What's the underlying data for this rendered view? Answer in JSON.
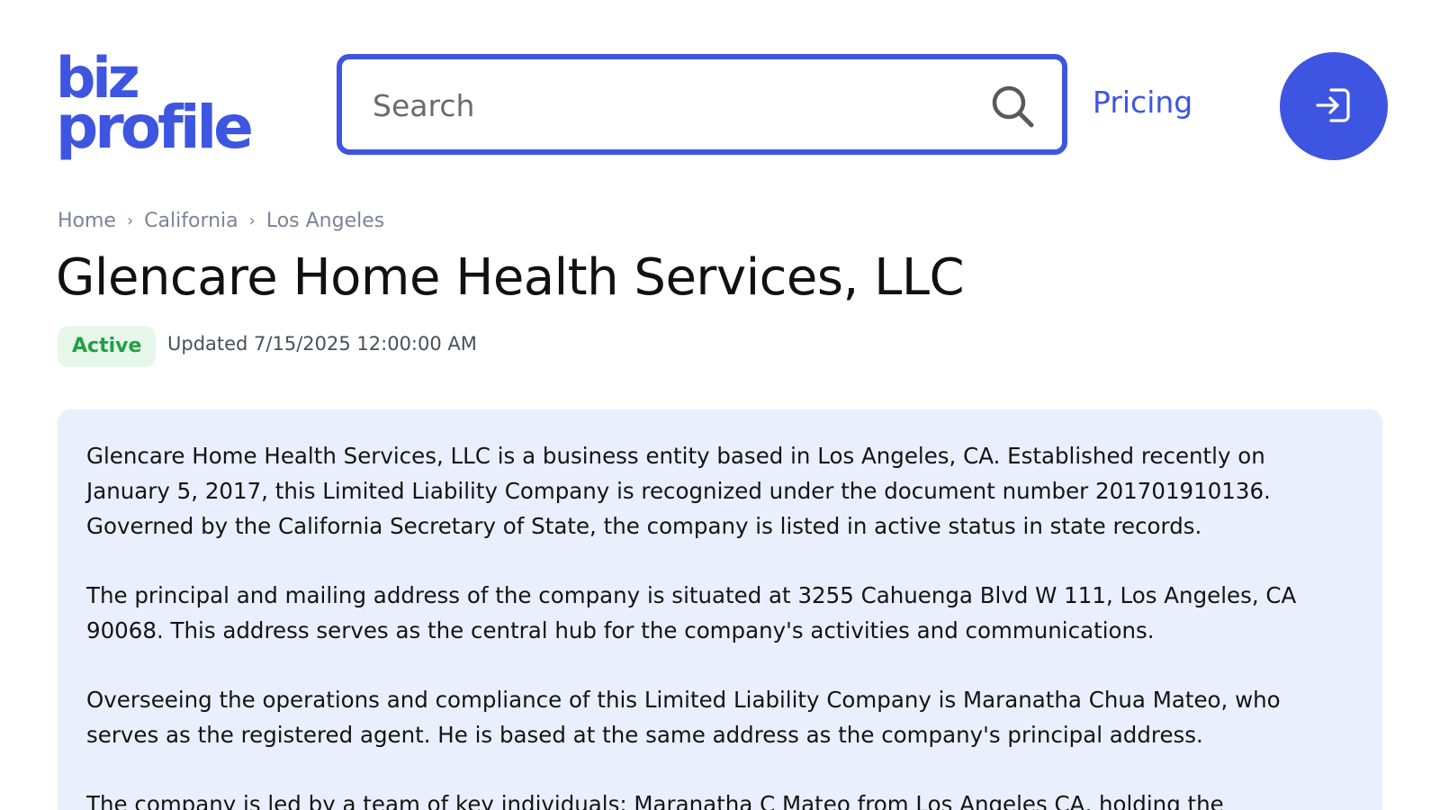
{
  "logo": {
    "line1": "biz",
    "line2": "profile"
  },
  "search": {
    "placeholder": "Search",
    "value": ""
  },
  "nav": {
    "pricing_label": "Pricing",
    "login_icon": "login-icon"
  },
  "breadcrumb": {
    "items": [
      "Home",
      "California",
      "Los Angeles"
    ],
    "separator": "›"
  },
  "business": {
    "name": "Glencare Home Health Services, LLC",
    "status": "Active",
    "updated": "Updated 7/15/2025 12:00:00 AM"
  },
  "description": {
    "paragraphs": [
      "Glencare Home Health Services, LLC is a business entity based in Los Angeles, CA. Established recently on January 5, 2017, this Limited Liability Company is recognized under the document number 201701910136. Governed by the California Secretary of State, the company is listed in active status in state records.",
      "The principal and mailing address of the company is situated at 3255 Cahuenga Blvd W 111, Los Angeles, CA 90068. This address serves as the central hub for the company's activities and communications.",
      "Overseeing the operations and compliance of this Limited Liability Company is Maranatha Chua Mateo, who serves as the registered agent. He is based at the same address as the company's principal address.",
      "The company is led by a team of key individuals: Maranatha C Mateo from Los Angeles CA, holding the"
    ]
  },
  "colors": {
    "brand": "#3d55e0",
    "status_active_bg": "#e6f7ea",
    "status_active_text": "#21a045",
    "card_bg": "#e9effc",
    "muted_text": "#7b8494"
  }
}
